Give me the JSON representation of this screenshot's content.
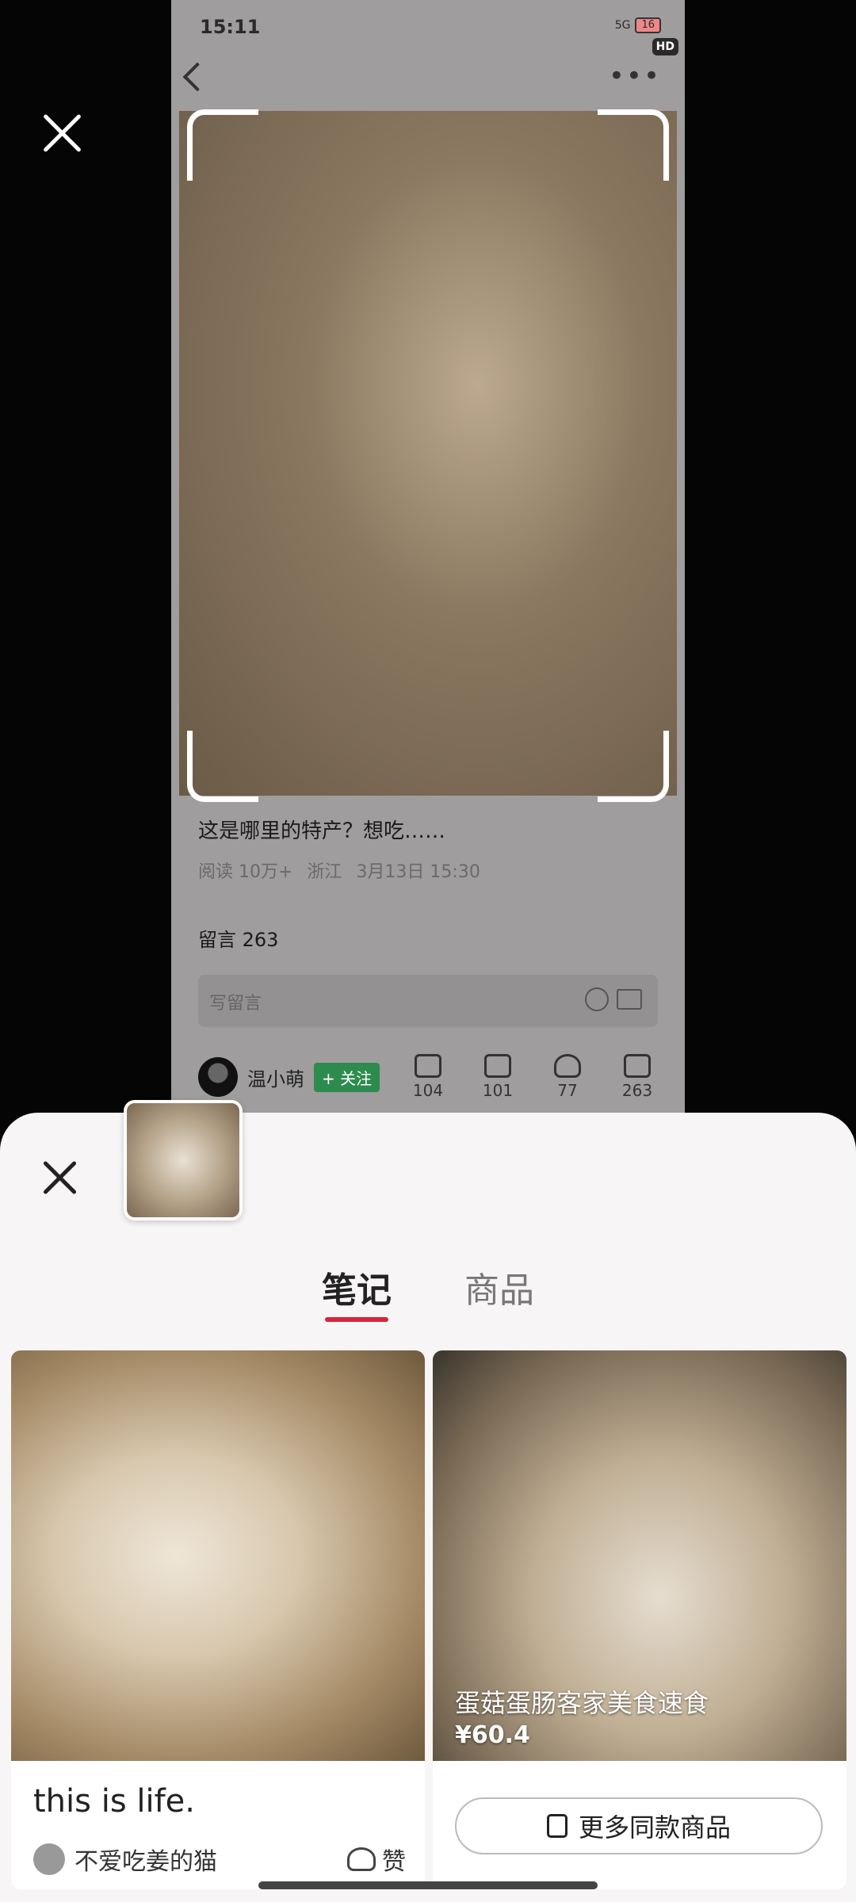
{
  "status_bar": {
    "time": "15:11",
    "network": "5G",
    "battery": "16",
    "hd_badge": "HD"
  },
  "post": {
    "caption": "这是哪里的特产？想吃……",
    "reads": "阅读 10万+",
    "location": "浙江",
    "datetime": "3月13日 15:30",
    "comments_title": "留言 263",
    "comment_placeholder": "写留言",
    "author_name": "温小萌",
    "follow_label": "+ 关注",
    "actions": [
      {
        "icon": "thumb-up-icon",
        "count": "104"
      },
      {
        "icon": "share-icon",
        "count": "101"
      },
      {
        "icon": "heart-icon",
        "count": "77"
      },
      {
        "icon": "comment-icon",
        "count": "263"
      }
    ]
  },
  "sheet": {
    "tabs": [
      {
        "label": "笔记"
      },
      {
        "label": "商品"
      }
    ],
    "note_card": {
      "title": "this is life.",
      "author": "不爱吃姜的猫",
      "like": "赞"
    },
    "product_card": {
      "title": "蛋菇蛋肠客家美食速食",
      "price": "¥60.4",
      "more_button": "更多同款商品"
    }
  }
}
